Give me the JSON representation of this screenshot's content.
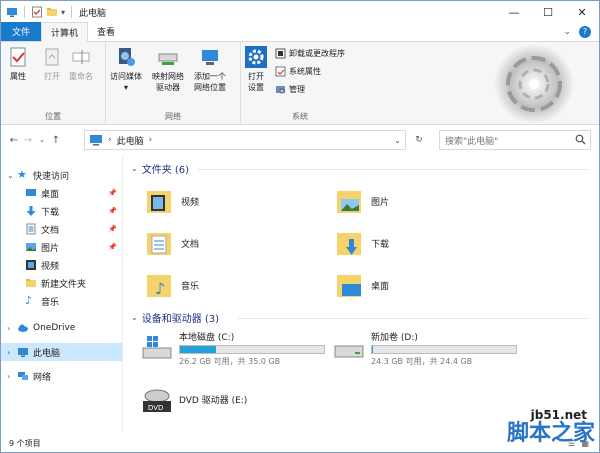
{
  "window": {
    "title": "此电脑"
  },
  "window_controls": {
    "minimize": "—",
    "maximize": "☐",
    "close": "✕"
  },
  "tabs": {
    "file": "文件",
    "computer": "计算机",
    "view": "查看"
  },
  "ribbon": {
    "location": {
      "label": "位置",
      "properties": "属性",
      "open": "打开",
      "rename": "重命名"
    },
    "network": {
      "label": "网络",
      "access_media": "访问媒体",
      "map_drive_1": "映射网络",
      "map_drive_2": "驱动器",
      "add_location_1": "添加一个",
      "add_location_2": "网络位置"
    },
    "system": {
      "label": "系统",
      "open_settings_1": "打开",
      "open_settings_2": "设置",
      "uninstall": "卸载或更改程序",
      "system_props": "系统属性",
      "manage": "管理"
    }
  },
  "address": {
    "path": "此电脑",
    "search_placeholder": "搜索\"此电脑\""
  },
  "nav": {
    "quick_access": "快速访问",
    "items": [
      {
        "label": "桌面",
        "pinned": true
      },
      {
        "label": "下载",
        "pinned": true
      },
      {
        "label": "文档",
        "pinned": true
      },
      {
        "label": "图片",
        "pinned": true
      },
      {
        "label": "视频",
        "pinned": false
      },
      {
        "label": "新建文件夹",
        "pinned": false
      },
      {
        "label": "音乐",
        "pinned": false
      }
    ],
    "onedrive": "OneDrive",
    "this_pc": "此电脑",
    "network": "网络"
  },
  "folders_header": "文件夹 (6)",
  "folders": [
    "视频",
    "图片",
    "文档",
    "下载",
    "音乐",
    "桌面"
  ],
  "devices_header": "设备和驱动器 (3)",
  "drives": [
    {
      "name": "本地磁盘 (C:)",
      "free": "26.2 GB 可用，共 35.0 GB",
      "used_fraction": 0.25
    },
    {
      "name": "新加卷 (D:)",
      "free": "24.3 GB 可用，共 24.4 GB",
      "used_fraction": 0.004
    }
  ],
  "dvd": {
    "name": "DVD 驱动器 (E:)",
    "badge": "DVD"
  },
  "status": "9 个项目",
  "watermark": {
    "line1": "jb51.net",
    "line2": "脚本之家"
  }
}
